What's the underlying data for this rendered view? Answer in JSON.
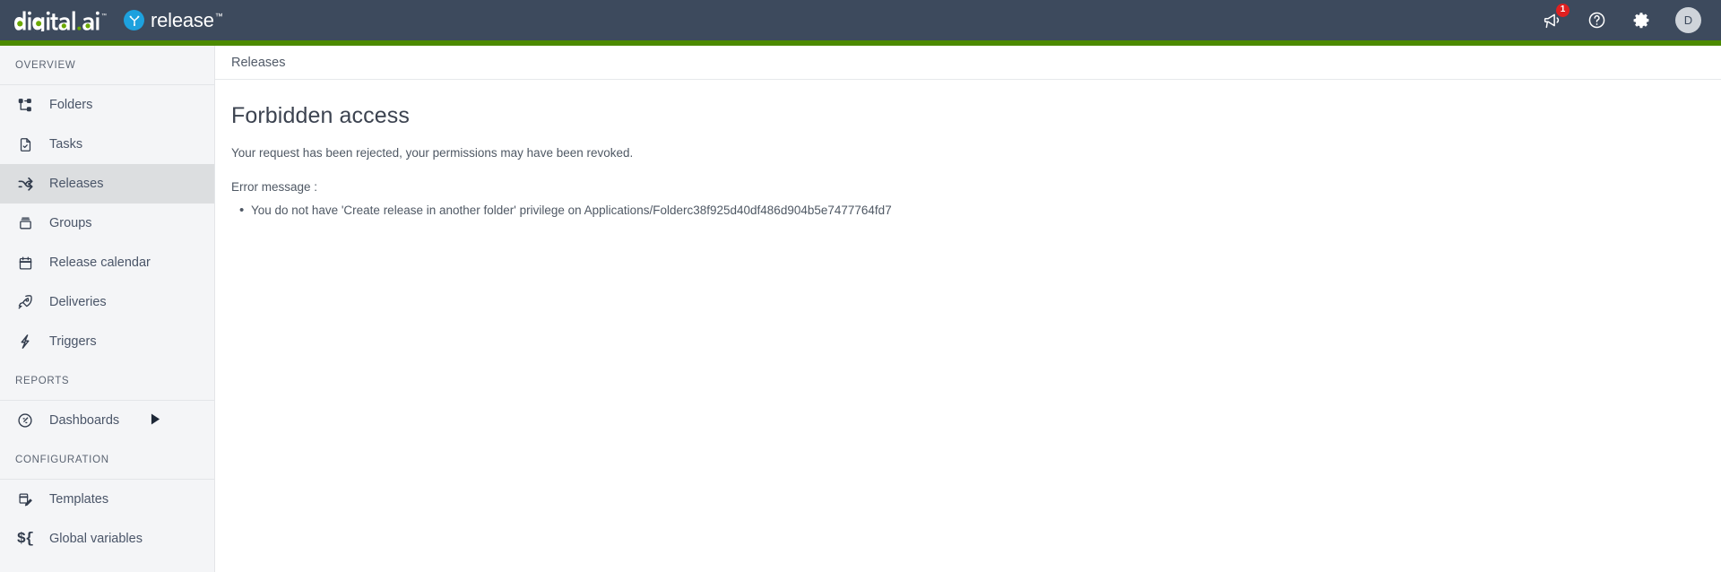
{
  "topbar": {
    "brand_primary": "digital.ai",
    "brand_product": "release",
    "brand_tm": "™",
    "release_mark_icon": "release-shuffle-icon",
    "notification_badge": "1",
    "icons": {
      "announcement": "megaphone-icon",
      "help": "help-circle-icon",
      "settings": "gear-icon"
    },
    "avatar_initial": "D"
  },
  "colors": {
    "header_bg": "#3d4a5d",
    "accent_green": "#4c8a00",
    "brand_dot_green": "#6aa800",
    "release_mark_blue": "#1da1de",
    "badge_red": "#e02020",
    "sidebar_bg": "#f4f5f7",
    "sidebar_selected_bg": "#dcdee0",
    "text_primary": "#4f5864"
  },
  "sidebar": {
    "sections": [
      {
        "label": "OVERVIEW",
        "items": [
          {
            "label": "Folders",
            "icon": "sitemap-icon",
            "selected": false,
            "caret": false
          },
          {
            "label": "Tasks",
            "icon": "document-check-icon",
            "selected": false,
            "caret": false
          },
          {
            "label": "Releases",
            "icon": "shuffle-icon",
            "selected": true,
            "caret": false
          },
          {
            "label": "Groups",
            "icon": "box-icon",
            "selected": false,
            "caret": false
          },
          {
            "label": "Release calendar",
            "icon": "calendar-icon",
            "selected": false,
            "caret": false
          },
          {
            "label": "Deliveries",
            "icon": "rocket-icon",
            "selected": false,
            "caret": false
          },
          {
            "label": "Triggers",
            "icon": "lightning-bolt-icon",
            "selected": false,
            "caret": false
          }
        ]
      },
      {
        "label": "REPORTS",
        "items": [
          {
            "label": "Dashboards",
            "icon": "gauge-icon",
            "selected": false,
            "caret": true
          }
        ]
      },
      {
        "label": "CONFIGURATION",
        "items": [
          {
            "label": "Templates",
            "icon": "template-pencil-icon",
            "selected": false,
            "caret": false
          },
          {
            "label": "Global variables",
            "icon": "dollar-brace-icon",
            "selected": false,
            "caret": false
          }
        ]
      }
    ]
  },
  "main": {
    "breadcrumb": [
      "Releases"
    ],
    "page_title": "Forbidden access",
    "lead_text": "Your request has been rejected, your permissions may have been revoked.",
    "error_label": "Error message :",
    "errors": [
      "You do not have 'Create release in another folder' privilege on Applications/Folderc38f925d40df486d904b5e7477764fd7"
    ]
  }
}
